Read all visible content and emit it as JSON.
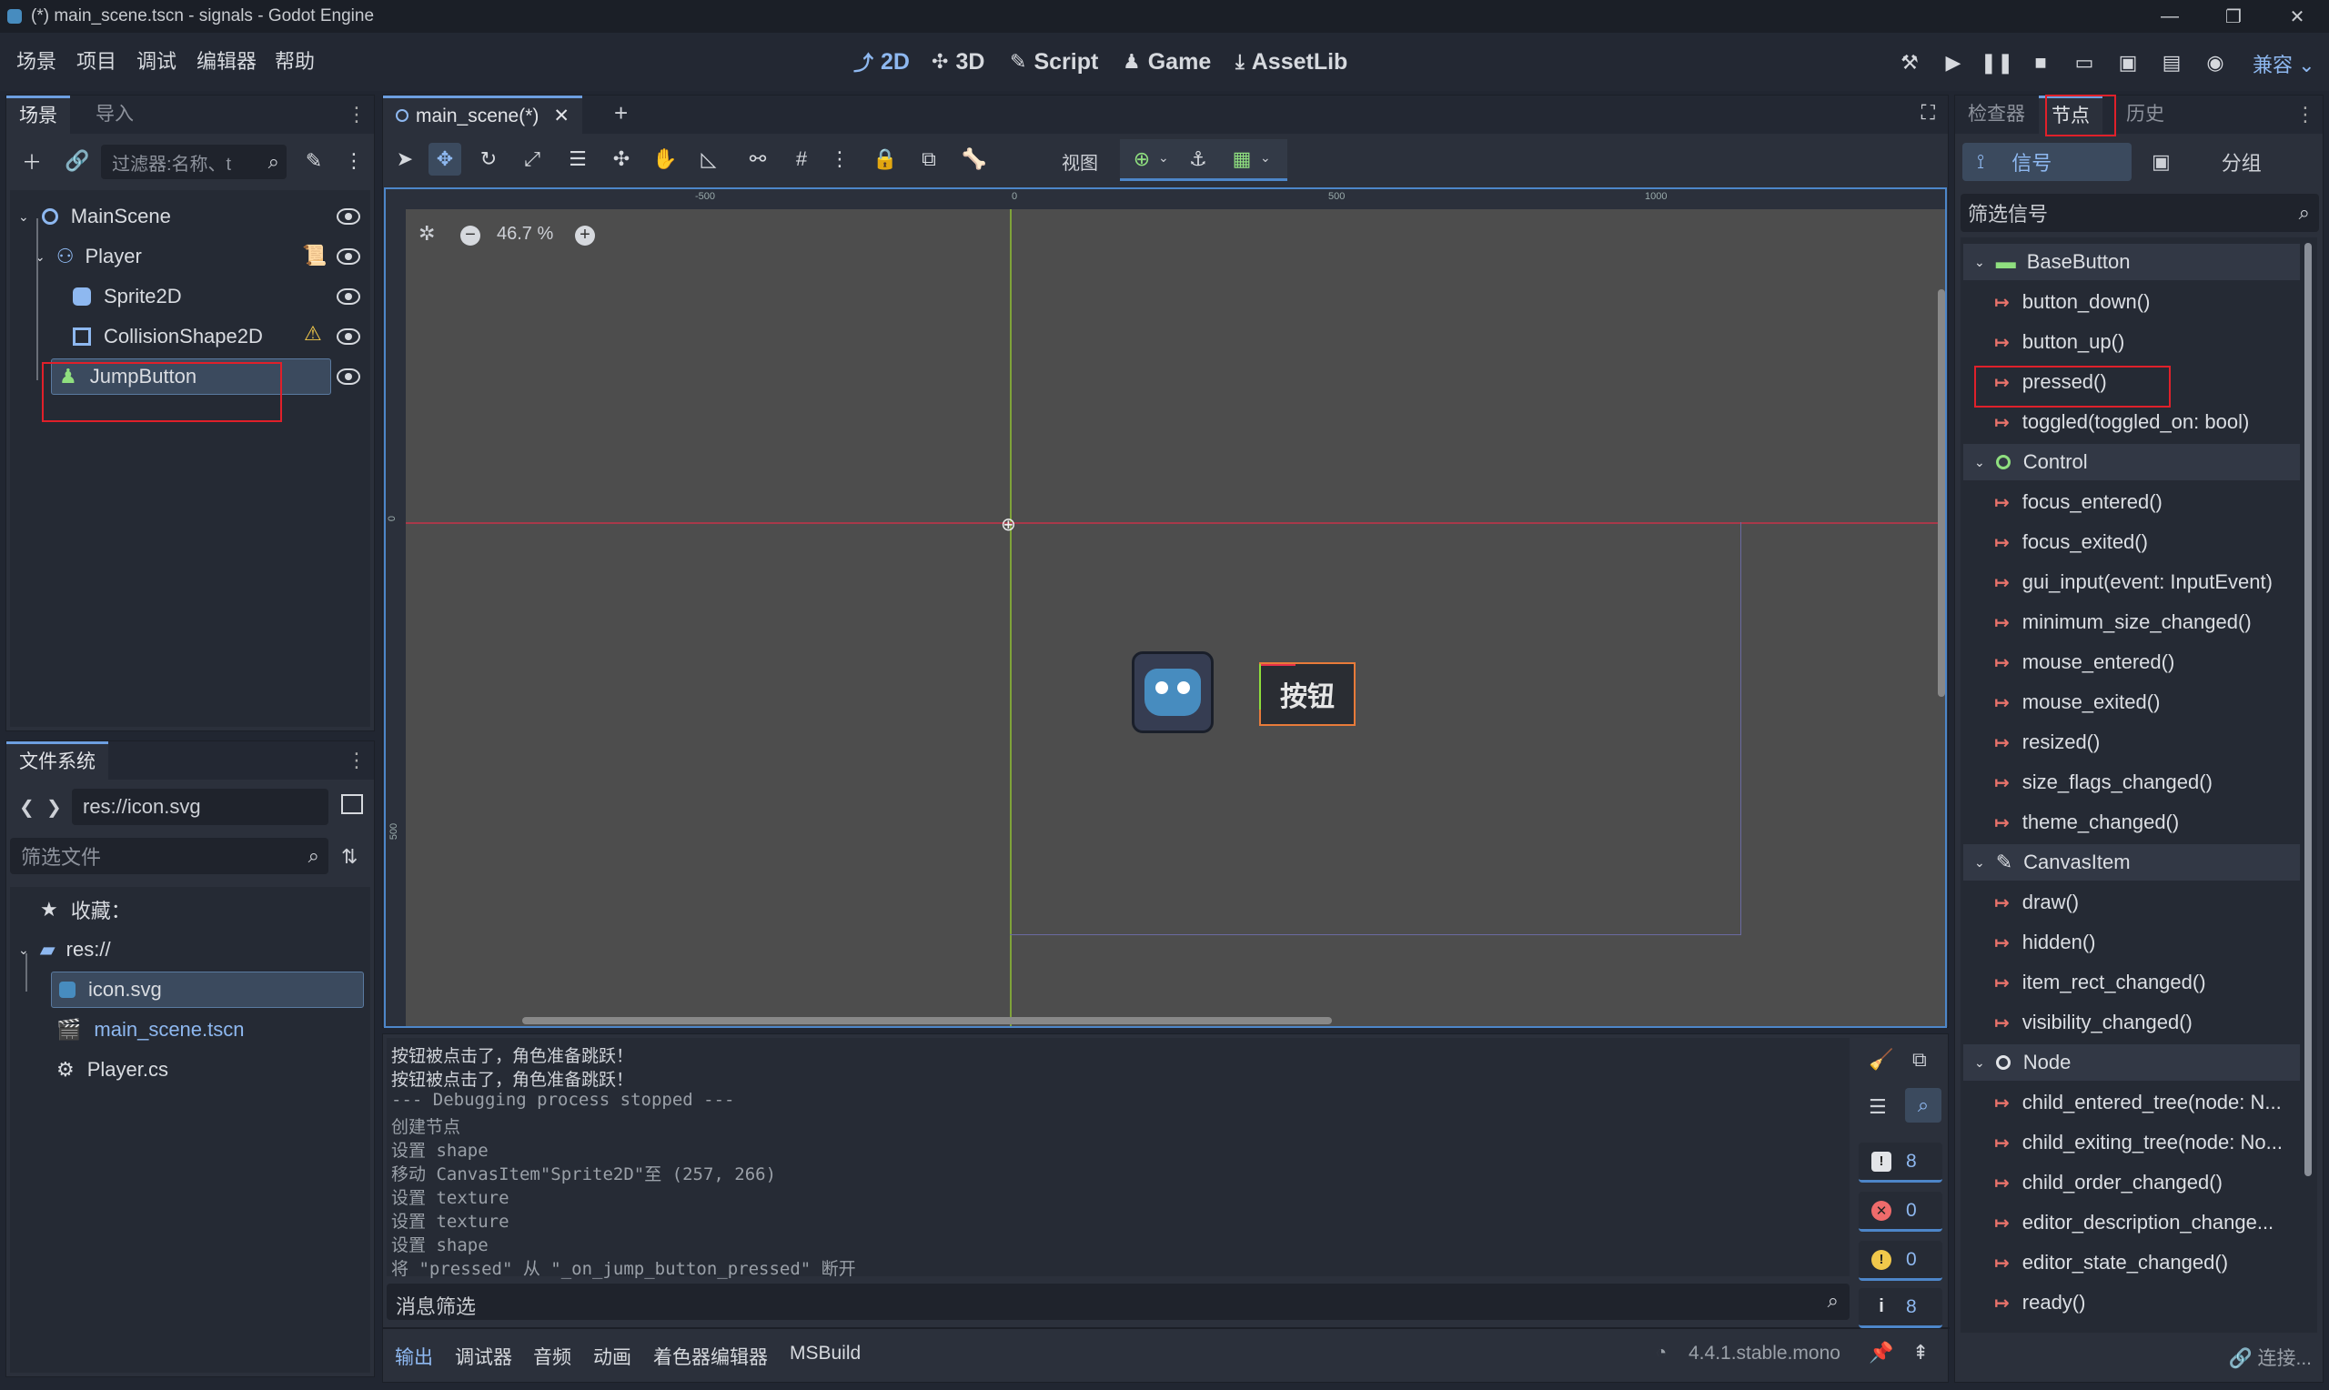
{
  "window": {
    "title": "(*) main_scene.tscn - signals - Godot Engine"
  },
  "menu": [
    "场景",
    "项目",
    "调试",
    "编辑器",
    "帮助"
  ],
  "workspaces": [
    {
      "label": "2D",
      "glyph": "⤴",
      "active": true
    },
    {
      "label": "3D",
      "glyph": "✣",
      "active": false
    },
    {
      "label": "Script",
      "glyph": "✎",
      "active": false
    },
    {
      "label": "Game",
      "glyph": "♟",
      "active": false
    },
    {
      "label": "AssetLib",
      "glyph": "⤓",
      "active": false
    }
  ],
  "run_controls": [
    "hammer-icon",
    "play-icon",
    "pause-icon",
    "stop-icon",
    "remote-icon",
    "play-scene-icon",
    "play-custom-icon",
    "movie-icon"
  ],
  "renderer": "兼容",
  "scene_dock": {
    "tabs": [
      "场景",
      "导入"
    ],
    "filter_placeholder": "过滤器:名称、t",
    "nodes": [
      {
        "name": "MainScene",
        "icon": "node2d-icon",
        "color": "#8eb8f0"
      },
      {
        "name": "Player",
        "icon": "characterbody-icon",
        "color": "#8eb8f0"
      },
      {
        "name": "Sprite2D",
        "icon": "sprite-icon",
        "color": "#8eb8f0"
      },
      {
        "name": "CollisionShape2D",
        "icon": "collision-icon",
        "color": "#8eb8f0"
      },
      {
        "name": "JumpButton",
        "icon": "button-icon",
        "color": "#8fdf7f"
      }
    ]
  },
  "filesystem": {
    "tab": "文件系统",
    "path": "res://icon.svg",
    "filter_placeholder": "筛选文件",
    "items": [
      "收藏：",
      "res://",
      "icon.svg",
      "main_scene.tscn",
      "Player.cs"
    ]
  },
  "editor": {
    "scene_tab": "main_scene(*)",
    "view_label": "视图",
    "zoom": "46.7 %",
    "ruler_labels": [
      "-500",
      "0",
      "500",
      "1000"
    ],
    "vruler_labels": [
      "0",
      "500"
    ],
    "button_text": "按钮"
  },
  "output": {
    "lines": [
      "按钮被点击了，角色准备跳跃！",
      "按钮被点击了，角色准备跳跃！",
      "--- Debugging process stopped ---",
      "创建节点",
      "设置 shape",
      "移动 CanvasItem\"Sprite2D\"至 (257, 266)",
      "设置 texture",
      "设置 texture",
      "设置 shape",
      "将 \"pressed\" 从 \"_on_jump_button_pressed\" 断开"
    ],
    "filter_placeholder": "消息筛选",
    "counters": [
      {
        "value": "8",
        "color": "#e2e4e8",
        "glyph": "!"
      },
      {
        "value": "0",
        "color": "#ef6b6b",
        "glyph": "✕"
      },
      {
        "value": "0",
        "color": "#f1c84b",
        "glyph": "!"
      },
      {
        "value": "8",
        "color": "#e2e4e8",
        "glyph": "i"
      }
    ]
  },
  "bottom_tabs": [
    "输出",
    "调试器",
    "音频",
    "动画",
    "着色器编辑器",
    "MSBuild"
  ],
  "version": "4.4.1.stable.mono",
  "right_dock": {
    "tabs": [
      "检查器",
      "节点",
      "历史"
    ],
    "subtabs": {
      "signals": "信号",
      "groups": "分组"
    },
    "filter_placeholder": "筛选信号",
    "groups": [
      {
        "name": "BaseButton",
        "signals": [
          "button_down()",
          "button_up()",
          "pressed()",
          "toggled(toggled_on: bool)"
        ]
      },
      {
        "name": "Control",
        "signals": [
          "focus_entered()",
          "focus_exited()",
          "gui_input(event: InputEvent)",
          "minimum_size_changed()",
          "mouse_entered()",
          "mouse_exited()",
          "resized()",
          "size_flags_changed()",
          "theme_changed()"
        ]
      },
      {
        "name": "CanvasItem",
        "signals": [
          "draw()",
          "hidden()",
          "item_rect_changed()",
          "visibility_changed()"
        ]
      },
      {
        "name": "Node",
        "signals": [
          "child_entered_tree(node: N...",
          "child_exiting_tree(node: No...",
          "child_order_changed()",
          "editor_description_change...",
          "editor_state_changed()",
          "ready()"
        ]
      }
    ],
    "connect_label": "连接..."
  }
}
